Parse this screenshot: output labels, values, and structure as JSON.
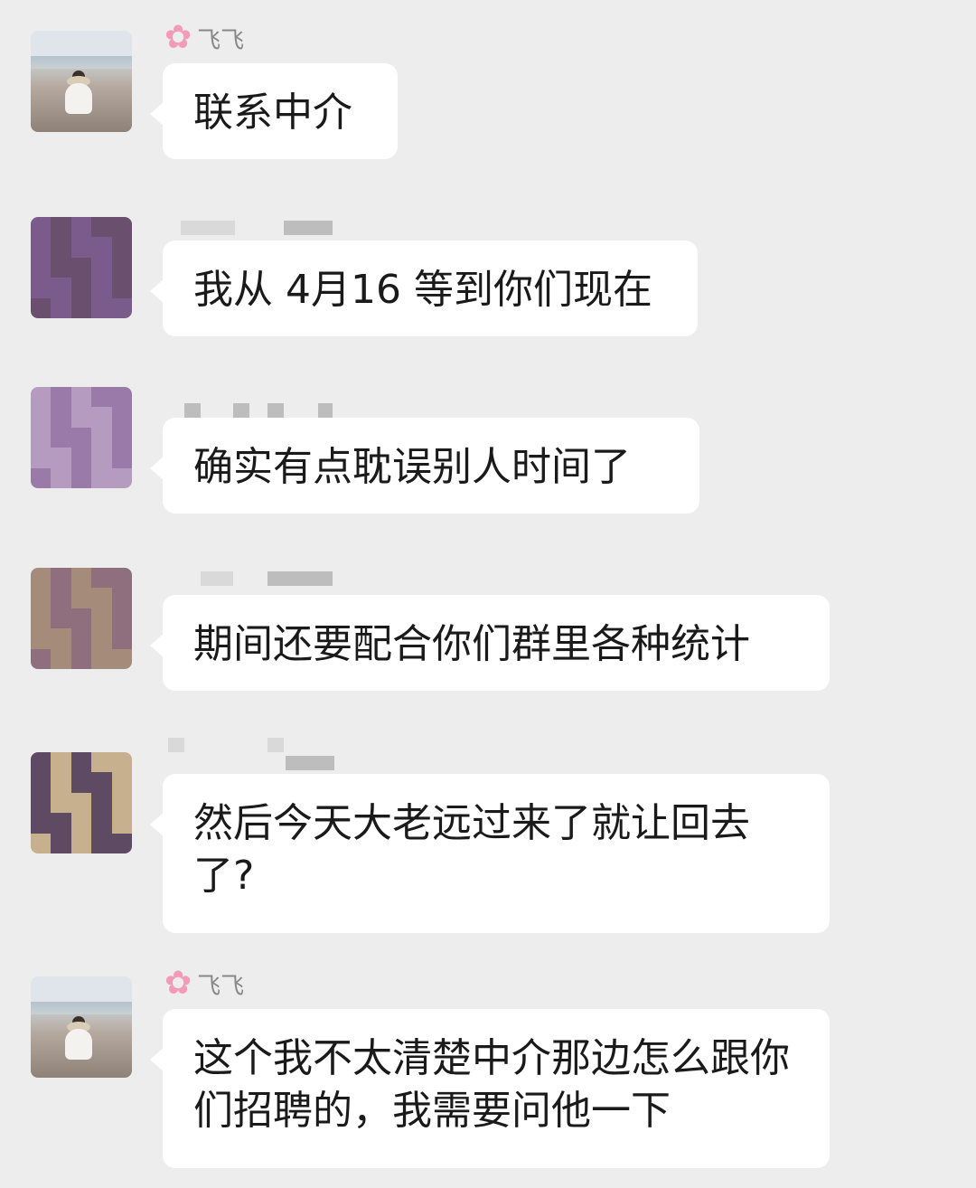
{
  "messages": [
    {
      "sender": "飞飞",
      "sender_icon": "flower-icon",
      "avatar": "beach-photo-avatar",
      "text": "联系中介"
    },
    {
      "sender": "",
      "sender_blurred": true,
      "avatar": "pixelated-avatar",
      "text": "我从 4月16 等到你们现在"
    },
    {
      "sender": "",
      "sender_blurred": true,
      "avatar": "pixelated-avatar",
      "text": "确实有点耽误别人时间了"
    },
    {
      "sender": "",
      "sender_blurred": true,
      "avatar": "pixelated-avatar",
      "text": "期间还要配合你们群里各种统计"
    },
    {
      "sender": "",
      "sender_blurred": true,
      "avatar": "pixelated-avatar",
      "text": "然后今天大老远过来了就让回去了?"
    },
    {
      "sender": "飞飞",
      "sender_icon": "flower-icon",
      "avatar": "beach-photo-avatar",
      "text": "这个我不太清楚中介那边怎么跟你们招聘的，我需要问他一下"
    }
  ],
  "colors": {
    "background": "#ededed",
    "bubble": "#ffffff",
    "text": "#1a1a1a",
    "sender_name": "#888888",
    "mosaic_palette": [
      "#7b5a8c",
      "#9a7aa8",
      "#a58b7a",
      "#c6b08e",
      "#6a4f6e",
      "#b59bc0",
      "#8f6f7d",
      "#5e4a63"
    ]
  }
}
